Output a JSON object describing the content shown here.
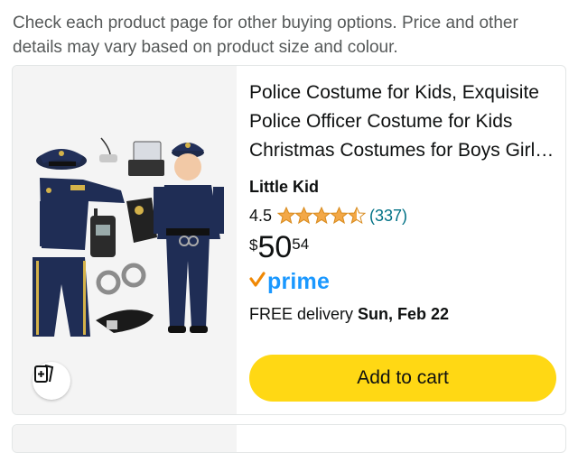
{
  "notice": "Check each product page for other buying options. Price and other details may vary based on product size and colour.",
  "product": {
    "title": "Police Costume for Kids, Exquisite Police Officer Costume for Kids Christmas Costumes for Boys Girls Role Play Halloween Dress Up",
    "size": "Little Kid",
    "rating": "4.5",
    "rating_value": 4.5,
    "reviews": "(337)",
    "price": {
      "symbol": "$",
      "whole": "50",
      "fraction": "54"
    },
    "prime_label": "prime",
    "delivery_prefix": "FREE delivery ",
    "delivery_date": "Sun, Feb 22",
    "cart_label": "Add to cart"
  },
  "icons": {
    "compare": "compare-cards-icon",
    "star": "star-icon",
    "prime_check": "prime-check-icon"
  },
  "colors": {
    "star": "#f3a847",
    "cart_button": "#ffd814",
    "prime_blue": "#1a98ff",
    "prime_check": "#f08804",
    "link": "#007185"
  }
}
